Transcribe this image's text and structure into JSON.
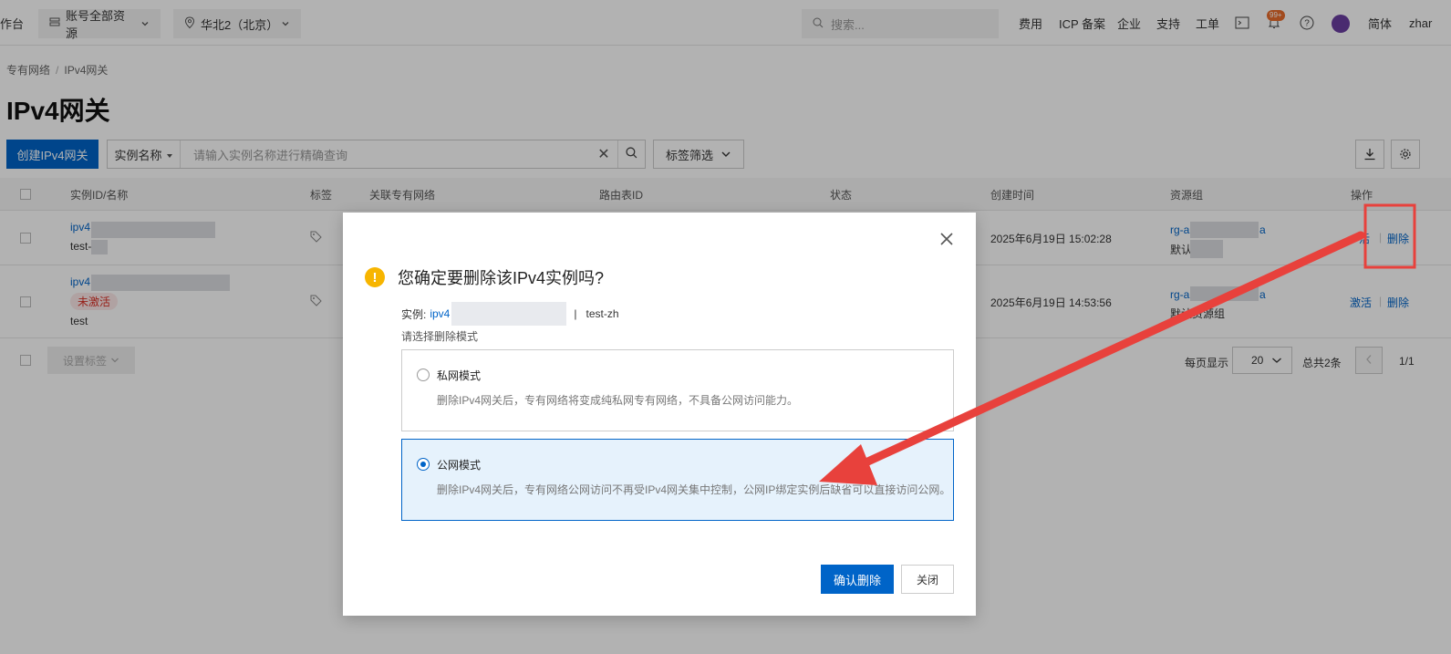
{
  "topbar": {
    "console_partial": "作台",
    "resource_scope": "账号全部资源",
    "region": "华北2（北京）",
    "search_placeholder": "搜索...",
    "links": [
      "费用",
      "ICP 备案",
      "企业",
      "支持",
      "工单"
    ],
    "badge": "99+",
    "language": "简体",
    "user_partial": "zhar"
  },
  "breadcrumb": [
    "专有网络",
    "IPv4网关"
  ],
  "page_title": "IPv4网关",
  "toolbar": {
    "create_label": "创建IPv4网关",
    "field_select": "实例名称",
    "search_placeholder": "请输入实例名称进行精确查询",
    "tag_filter": "标签筛选"
  },
  "table": {
    "headers": [
      "实例ID/名称",
      "标签",
      "关联专有网络",
      "路由表ID",
      "状态",
      "创建时间",
      "资源组",
      "操作"
    ],
    "rows": [
      {
        "id": "ipv4",
        "name": "test-",
        "status": "",
        "created": "2025年6月19日 15:02:28",
        "rg": "rg-a",
        "rg_suffix": "a",
        "rg_name": "默认",
        "actions": [
          "激活",
          "删除"
        ],
        "actions_visible": [
          "活",
          "删除"
        ]
      },
      {
        "id": "ipv4",
        "name": "test",
        "status": "未激活",
        "created": "2025年6月19日 14:53:56",
        "rg": "rg-a",
        "rg_suffix": "a",
        "rg_name": "默认资源组",
        "actions": [
          "激活",
          "删除"
        ]
      }
    ]
  },
  "footer": {
    "bulk_label": "设置标签",
    "per_page_label": "每页显示",
    "per_page_value": "20",
    "total": "总共2条",
    "page": "1/1"
  },
  "modal": {
    "title": "您确定要删除该IPv4实例吗?",
    "instance_label": "实例:",
    "instance_id": "ipv4",
    "instance_name": "test-zh",
    "mode_prompt": "请选择删除模式",
    "options": [
      {
        "title": "私网模式",
        "desc": "删除IPv4网关后，专有网络将变成纯私网专有网络，不具备公网访问能力。",
        "selected": false
      },
      {
        "title": "公网模式",
        "desc": "删除IPv4网关后，专有网络公网访问不再受IPv4网关集中控制，公网IP绑定实例后缺省可以直接访问公网。",
        "selected": true
      }
    ],
    "confirm_label": "确认删除",
    "close_label": "关闭"
  },
  "colors": {
    "primary": "#0064c8",
    "warning": "#f7b500",
    "annotation": "#e8413c"
  }
}
